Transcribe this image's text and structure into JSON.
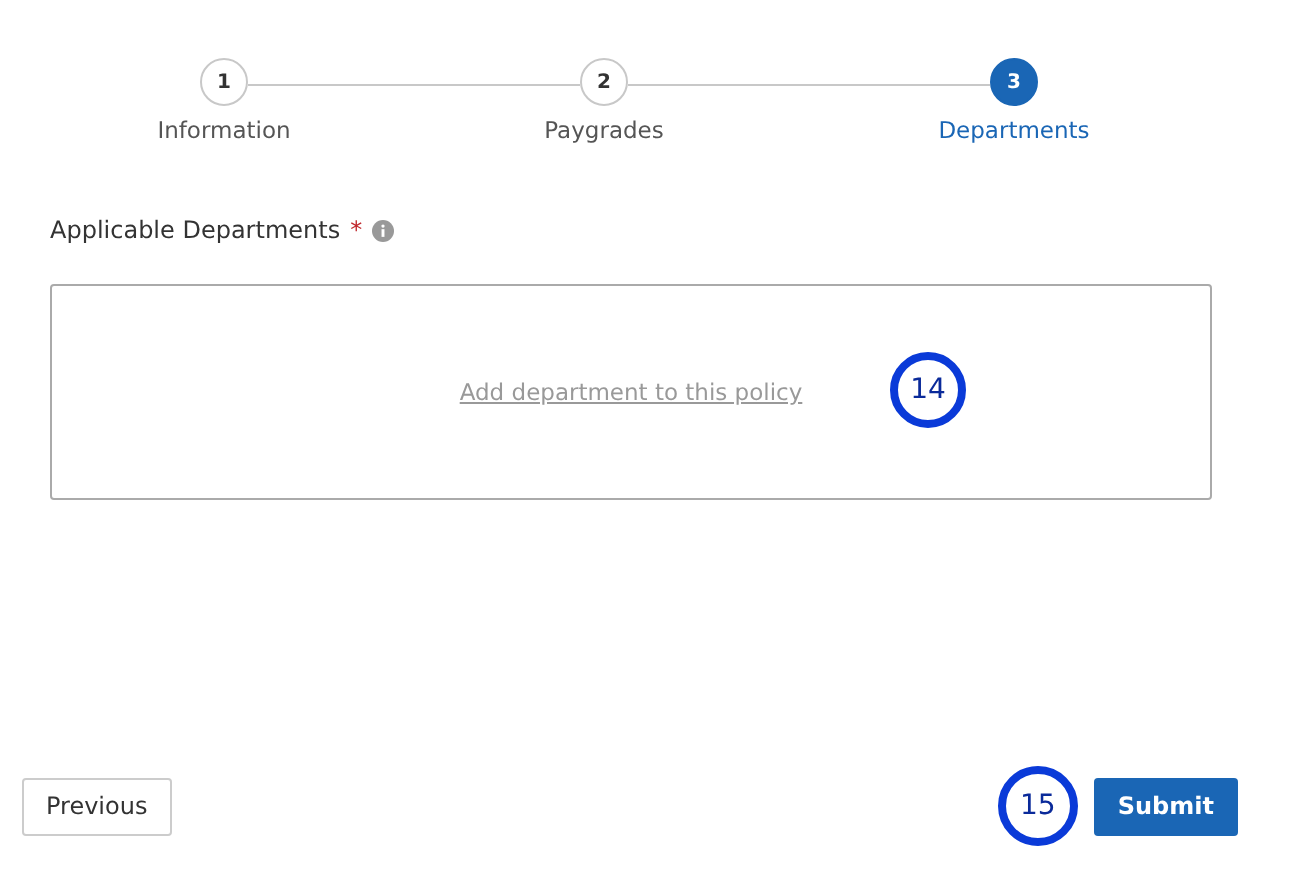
{
  "steps": [
    {
      "number": "1",
      "label": "Information",
      "selected": false
    },
    {
      "number": "2",
      "label": "Paygrades",
      "selected": false
    },
    {
      "number": "3",
      "label": "Departments",
      "selected": true
    }
  ],
  "field": {
    "label": "Applicable Departments",
    "required_mark": "*",
    "action": "Add department to this policy",
    "marker": "14"
  },
  "footer": {
    "previous": "Previous",
    "submit": "Submit",
    "marker": "15"
  }
}
